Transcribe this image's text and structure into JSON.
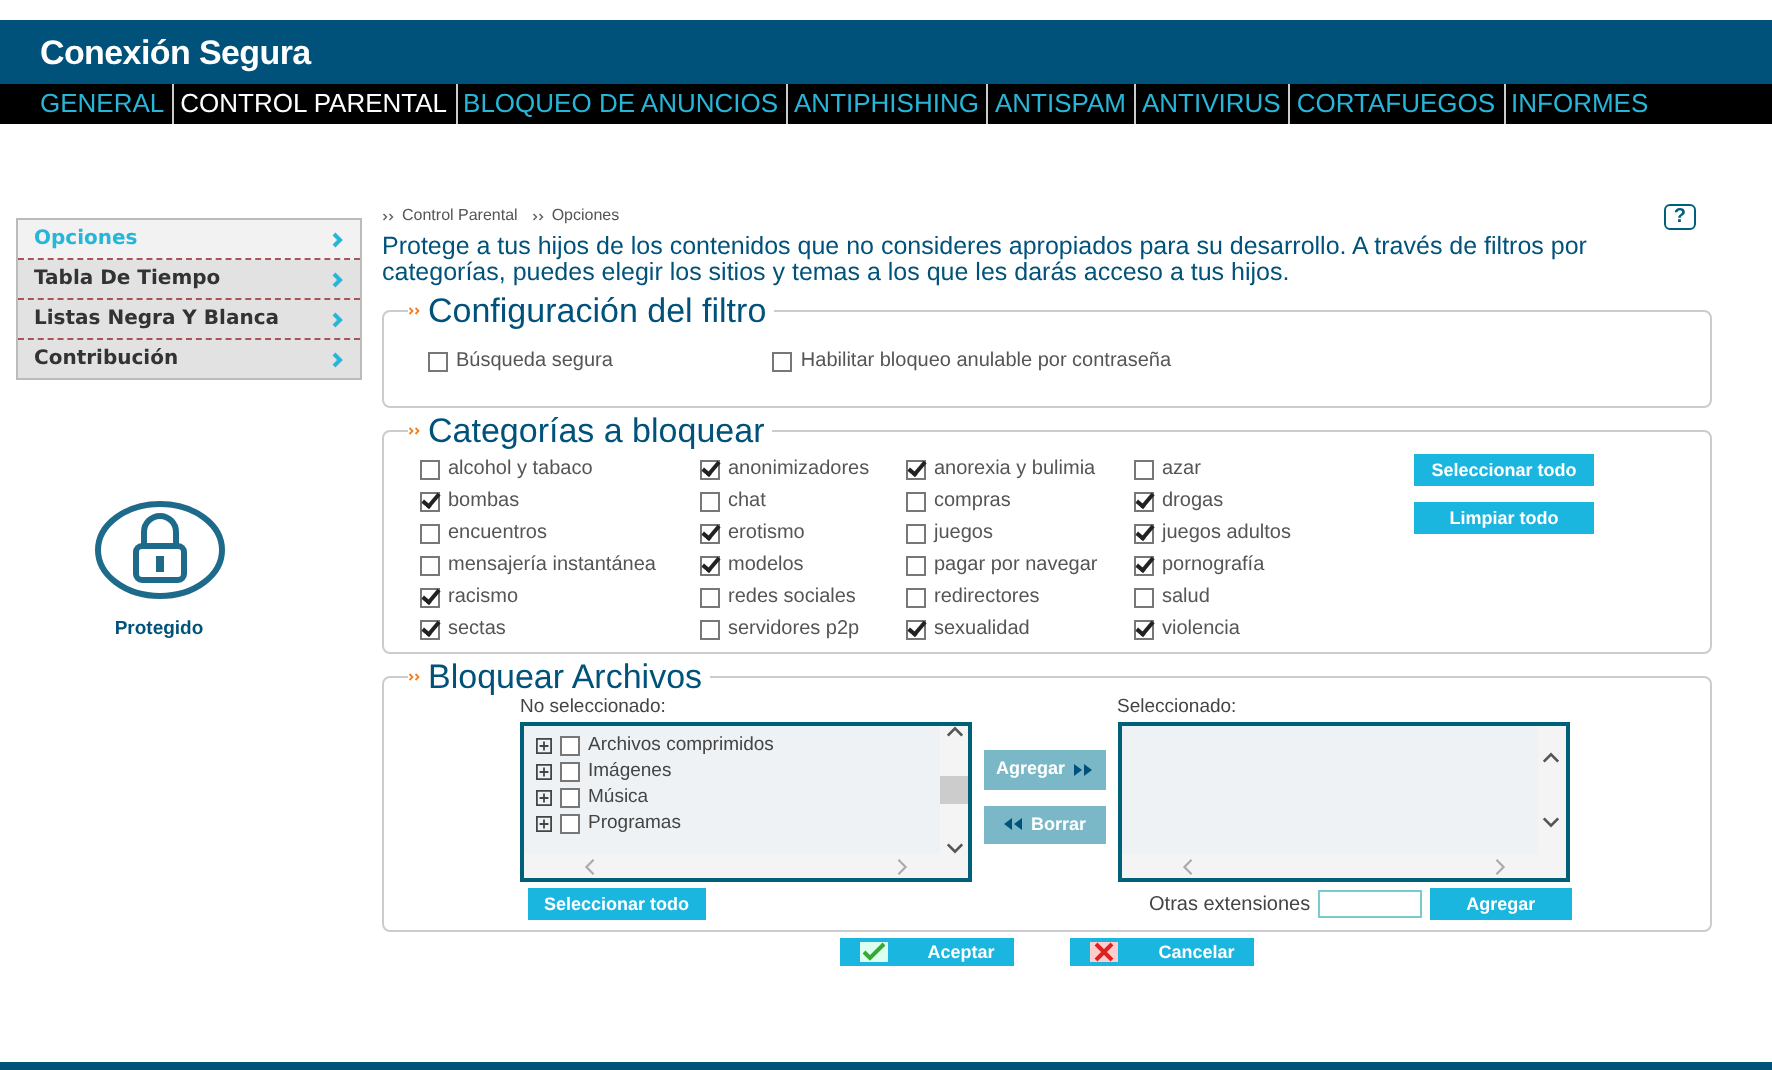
{
  "app_title": "Conexión Segura",
  "nav": [
    {
      "label": "GENERAL",
      "selected": false
    },
    {
      "label": "CONTROL PARENTAL",
      "selected": true
    },
    {
      "label": "BLOQUEO DE ANUNCIOS",
      "selected": false
    },
    {
      "label": "ANTIPHISHING",
      "selected": false
    },
    {
      "label": "ANTISPAM",
      "selected": false
    },
    {
      "label": "ANTIVIRUS",
      "selected": false
    },
    {
      "label": "CORTAFUEGOS",
      "selected": false
    },
    {
      "label": "INFORMES",
      "selected": false
    }
  ],
  "sidebar": {
    "items": [
      {
        "label": "Opciones",
        "selected": true
      },
      {
        "label": "Tabla De Tiempo",
        "selected": false
      },
      {
        "label": "Listas Negra Y Blanca",
        "selected": false
      },
      {
        "label": "Contribución",
        "selected": false
      }
    ],
    "status": "Protegido"
  },
  "breadcrumb": [
    "Control Parental",
    "Opciones"
  ],
  "help": "?",
  "intro": "Protege a tus hijos de los contenidos que no consideres apropiados para su desarrollo. A través de filtros por categorías, puedes elegir los sitios y temas a los que les darás acceso a tus hijos.",
  "filter": {
    "title": "Configuración del filtro",
    "options": [
      {
        "label": "Búsqueda segura",
        "checked": false
      },
      {
        "label": "Habilitar bloqueo anulable por contraseña",
        "checked": false
      }
    ]
  },
  "categories": {
    "title": "Categorías a bloquear",
    "items": [
      {
        "label": "alcohol y tabaco",
        "checked": false
      },
      {
        "label": "anonimizadores",
        "checked": true
      },
      {
        "label": "anorexia y bulimia",
        "checked": true
      },
      {
        "label": "azar",
        "checked": false
      },
      {
        "label": "bombas",
        "checked": true
      },
      {
        "label": "chat",
        "checked": false
      },
      {
        "label": "compras",
        "checked": false
      },
      {
        "label": "drogas",
        "checked": true
      },
      {
        "label": "encuentros",
        "checked": false
      },
      {
        "label": "erotismo",
        "checked": true
      },
      {
        "label": "juegos",
        "checked": false
      },
      {
        "label": "juegos adultos",
        "checked": true
      },
      {
        "label": "mensajería instantánea",
        "checked": false
      },
      {
        "label": "modelos",
        "checked": true
      },
      {
        "label": "pagar por navegar",
        "checked": false
      },
      {
        "label": "pornografía",
        "checked": true
      },
      {
        "label": "racismo",
        "checked": true
      },
      {
        "label": "redes sociales",
        "checked": false
      },
      {
        "label": "redirectores",
        "checked": false
      },
      {
        "label": "salud",
        "checked": false
      },
      {
        "label": "sectas",
        "checked": true
      },
      {
        "label": "servidores p2p",
        "checked": false
      },
      {
        "label": "sexualidad",
        "checked": true
      },
      {
        "label": "violencia",
        "checked": true
      }
    ],
    "buttons": [
      "Seleccionar todo",
      "Limpiar todo"
    ]
  },
  "files": {
    "title": "Bloquear Archivos",
    "left_label": "No seleccionado:",
    "right_label": "Seleccionado:",
    "tree": [
      {
        "label": "Archivos comprimidos",
        "checked": false
      },
      {
        "label": "Imágenes",
        "checked": false
      },
      {
        "label": "Música",
        "checked": false
      },
      {
        "label": "Programas",
        "checked": false
      }
    ],
    "add": "Agregar",
    "remove": "Borrar",
    "select_all": "Seleccionar todo",
    "ext_label": "Otras extensiones",
    "ext_add": "Agregar"
  },
  "actions": {
    "ok": "Aceptar",
    "cancel": "Cancelar"
  }
}
